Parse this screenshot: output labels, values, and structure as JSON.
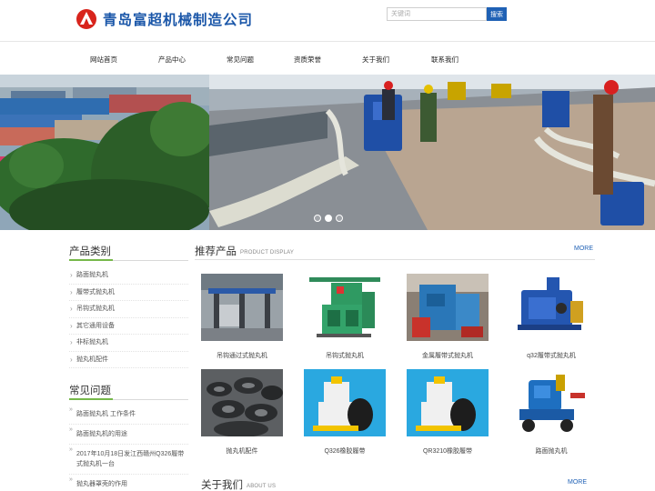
{
  "header": {
    "company_name": "青岛富超机械制造公司",
    "search_placeholder": "关键词",
    "search_button": "搜索"
  },
  "nav": {
    "items": [
      "网站首页",
      "产品中心",
      "常见问题",
      "资质荣誉",
      "关于我们",
      "联系我们"
    ]
  },
  "banner": {
    "slide_count": 3,
    "active_slide": 2
  },
  "sidebar": {
    "categories_title": "产品类别",
    "categories": [
      "路面抛丸机",
      "履带式抛丸机",
      "吊钩式抛丸机",
      "其它通用设备",
      "非标抛丸机",
      "抛丸机配件"
    ],
    "faq_title": "常见问题",
    "faq": [
      "路面抛丸机 工作条件",
      "路面抛丸机的用途",
      "2017年10月18日发江西赣州Q326履带式抛丸机一台",
      "抛丸器罩壳的作用"
    ]
  },
  "products": {
    "title": "推荐产品",
    "subtitle": "PRODUCT DISPLAY",
    "more": "MORE",
    "items": [
      {
        "name": "吊钩通过式抛丸机",
        "thumb": "factory-interior"
      },
      {
        "name": "吊钩式抛丸机",
        "thumb": "hook-machine"
      },
      {
        "name": "金属履带式抛丸机",
        "thumb": "metal-track-machine"
      },
      {
        "name": "q32履带式抛丸机",
        "thumb": "blue-tumble-machine"
      },
      {
        "name": "抛丸机配件",
        "thumb": "parts-pile"
      },
      {
        "name": "Q326橡胶履带",
        "thumb": "rubber-track-machine"
      },
      {
        "name": "QR3210橡胶履带",
        "thumb": "rubber-track-machine"
      },
      {
        "name": "路面抛丸机",
        "thumb": "road-blaster"
      }
    ]
  },
  "about": {
    "title": "关于我们",
    "subtitle": "ABOUT US",
    "more": "MORE"
  },
  "colors": {
    "brand_blue": "#1b57a9",
    "button_blue": "#1f61b5",
    "logo_red": "#d8241c",
    "accent_green": "#76b84a"
  }
}
